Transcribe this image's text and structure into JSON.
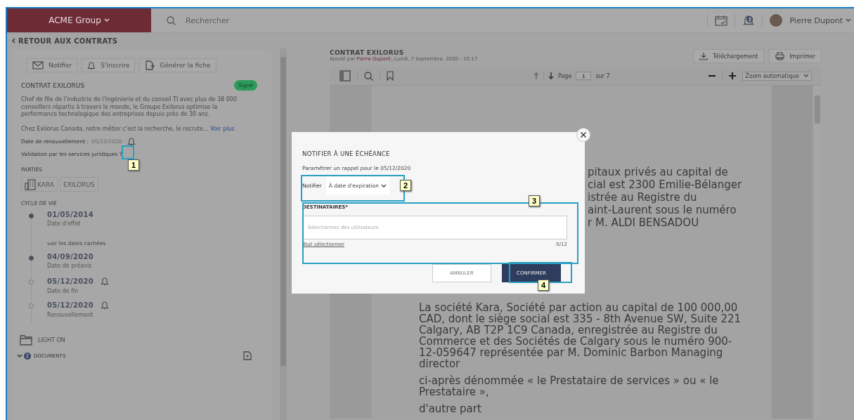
{
  "topbar": {
    "org": "ACME Group",
    "search_placeholder": "Rechercher",
    "notification_count": "2",
    "user": "Pierre Dupont"
  },
  "back_link": "RETOUR AUX CONTRATS",
  "sidebar": {
    "actions": [
      {
        "label": "Notifier",
        "kind": "mail"
      },
      {
        "label": "S'inscrire",
        "kind": "bell"
      },
      {
        "label": "Générer la fiche",
        "kind": "export"
      }
    ],
    "title": "CONTRAT EXILORUS",
    "status": "Signé",
    "description": "Chef de file de l'industrie de l'ingénierie et du conseil TI avec plus de 38 000 conseillers répartis à travers le monde, le Groupe Exilorus optimise la performance technologique des entreprises depuis près de 30 ans.",
    "excerpt": "Chez Exilorus Canada, notre métier c'est la recherche, le recrute...",
    "more_link": "Voir plus",
    "fields": [
      {
        "label": "Date de renouvellement :",
        "value": "05/12/2020",
        "bell": true
      },
      {
        "label": "Validation par les services juridiques ?",
        "bell": false
      }
    ],
    "parties_heading": "PARTIES",
    "parties": [
      {
        "name": "KARA",
        "kind": "company"
      },
      {
        "name": "EXILORUS",
        "kind": "plain"
      }
    ],
    "lifecycle_heading": "CYCLE DE VIE",
    "lifecycle": [
      {
        "kind": "event",
        "date": "01/05/2014",
        "label": "Date d'effet",
        "reached": true,
        "bell": false
      },
      {
        "kind": "link",
        "text": "voir les dates cachées"
      },
      {
        "kind": "event",
        "date": "04/09/2020",
        "label": "Date de préavis",
        "reached": true,
        "bell": false
      },
      {
        "kind": "event",
        "date": "05/12/2020",
        "label": "Date de fin",
        "reached": false,
        "bell": true
      },
      {
        "kind": "event",
        "date": "05/12/2020",
        "label": "Renouvellement",
        "reached": false,
        "bell": true
      }
    ],
    "light_on": "LIGHT ON",
    "documents": {
      "count": "2",
      "label": "DOCUMENTS",
      "expanded": true
    }
  },
  "viewer": {
    "title": "CONTRAT EXILORUS",
    "added_prefix": "Ajouté par",
    "added_by": "Pierre Dupont",
    "added_suffix": ", Lundi, 7 Septembre, 2020 - 10:17",
    "download": "Téléchargement",
    "print": "Imprimer",
    "page_label": "Page",
    "page": "1",
    "page_total": "sur 7",
    "zoom": "Zoom automatique",
    "partial_lines": [
      "pitaux privés au capital de",
      "cial est 2300 Emilie-Bélanger",
      "istrée au Registre du",
      "aint-Laurent sous le numéro",
      "r M. ALDI BENSADOU"
    ],
    "paragraphs": [
      "La société Kara, Société par action au capital de 100 000,00 CAD, dont le siège social est 335 - 8th Avenue SW, Suite 221 Calgary, AB T2P 1C9 Canada, enregistrée au Registre du Commerce et des Sociétés de Calgary sous le numéro 900-12-059647 représentée par M. Dominic Barbon Managing director",
      "ci-après dénommée « le Prestataire de services » ou « le Prestataire »,",
      "d'autre part"
    ]
  },
  "modal": {
    "title": "NOTIFIER À UNE ÉCHÉANCE",
    "subtitle": "Paramétrer un rappel pour le 05/12/2020",
    "notify_label": "Notifier",
    "notify_value": "À date d'expiration",
    "recipients_label": "DESTINATAIRES*",
    "recipients_placeholder": "Sélectionnez des utilisateurs",
    "select_all": "Tout sélectionner",
    "counter": "0/12",
    "cancel": "ANNULER",
    "confirm": "CONFIRMER"
  },
  "callouts": [
    {
      "label": "1"
    },
    {
      "label": "2"
    },
    {
      "label": "3"
    },
    {
      "label": "4"
    }
  ]
}
